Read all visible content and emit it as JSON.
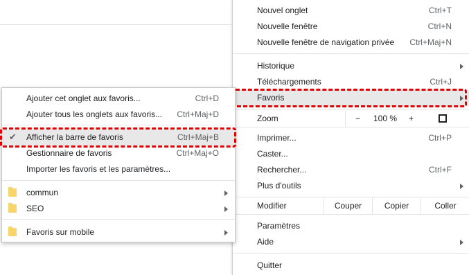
{
  "main_menu": {
    "new_tab": {
      "label": "Nouvel onglet",
      "shortcut": "Ctrl+T"
    },
    "new_window": {
      "label": "Nouvelle fenêtre",
      "shortcut": "Ctrl+N"
    },
    "incognito": {
      "label": "Nouvelle fenêtre de navigation privée",
      "shortcut": "Ctrl+Maj+N"
    },
    "history": {
      "label": "Historique"
    },
    "downloads": {
      "label": "Téléchargements",
      "shortcut": "Ctrl+J"
    },
    "bookmarks": {
      "label": "Favoris"
    },
    "zoom": {
      "label": "Zoom",
      "minus": "−",
      "value": "100 %",
      "plus": "+"
    },
    "print": {
      "label": "Imprimer...",
      "shortcut": "Ctrl+P"
    },
    "cast": {
      "label": "Caster..."
    },
    "find": {
      "label": "Rechercher...",
      "shortcut": "Ctrl+F"
    },
    "more_tools": {
      "label": "Plus d'outils"
    },
    "edit": {
      "label": "Modifier",
      "cut": "Couper",
      "copy": "Copier",
      "paste": "Coller"
    },
    "settings": {
      "label": "Paramètres"
    },
    "help": {
      "label": "Aide"
    },
    "quit": {
      "label": "Quitter"
    }
  },
  "bookmarks_menu": {
    "add_tab": {
      "label": "Ajouter cet onglet aux favoris...",
      "shortcut": "Ctrl+D"
    },
    "add_all": {
      "label": "Ajouter tous les onglets aux favoris...",
      "shortcut": "Ctrl+Maj+D"
    },
    "show_bar": {
      "label": "Afficher la barre de favoris",
      "shortcut": "Ctrl+Maj+B",
      "checked": true
    },
    "manager": {
      "label": "Gestionnaire de favoris",
      "shortcut": "Ctrl+Maj+O"
    },
    "import": {
      "label": "Importer les favoris et les paramètres..."
    },
    "folders": [
      {
        "label": "commun",
        "icon": "folder-icon"
      },
      {
        "label": "SEO",
        "icon": "folder-icon"
      }
    ],
    "mobile": {
      "label": "Favoris sur mobile",
      "icon": "folder-icon"
    }
  },
  "highlight_color": "#e00000",
  "folder_color": "#f8d56b"
}
